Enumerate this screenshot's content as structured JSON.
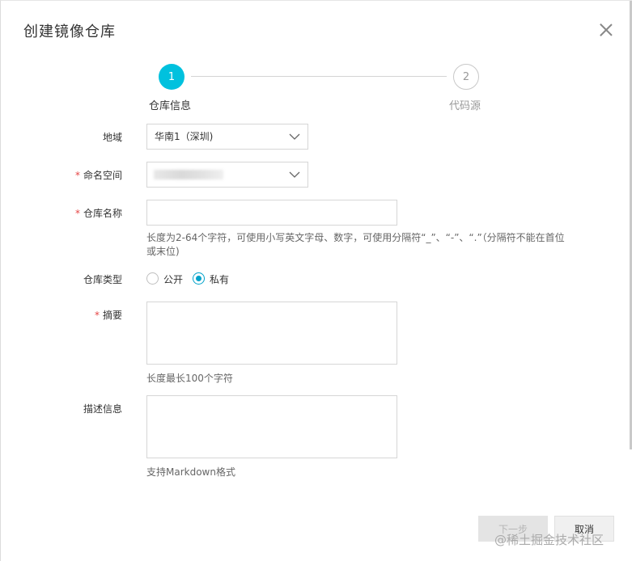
{
  "dialog": {
    "title": "创建镜像仓库"
  },
  "steps": [
    {
      "number": "1",
      "label": "仓库信息",
      "active": true
    },
    {
      "number": "2",
      "label": "代码源",
      "active": false
    }
  ],
  "form": {
    "region": {
      "label": "地域",
      "value": "华南1（深圳)"
    },
    "namespace": {
      "label": "命名空间",
      "required_mark": "*"
    },
    "repo_name": {
      "label": "仓库名称",
      "required_mark": "*",
      "value": "",
      "hint_line1": "长度为2-64个字符，可使用小写英文字母、数字，可使用分隔符“_”、“-”、“.”（分隔符不能在首位",
      "hint_line2": "或末位)"
    },
    "repo_type": {
      "label": "仓库类型",
      "options": [
        "公开",
        "私有"
      ],
      "selected": "私有"
    },
    "summary": {
      "label": "摘要",
      "required_mark": "*",
      "value": "",
      "hint": "长度最长100个字符"
    },
    "description": {
      "label": "描述信息",
      "value": "",
      "hint": "支持Markdown格式"
    }
  },
  "footer": {
    "next_label": "下一步",
    "cancel_label": "取消"
  },
  "watermark": "@稀土掘金技术社区",
  "colors": {
    "accent": "#00c1de",
    "radio_checked": "#00a2ca",
    "required": "#e64545"
  }
}
